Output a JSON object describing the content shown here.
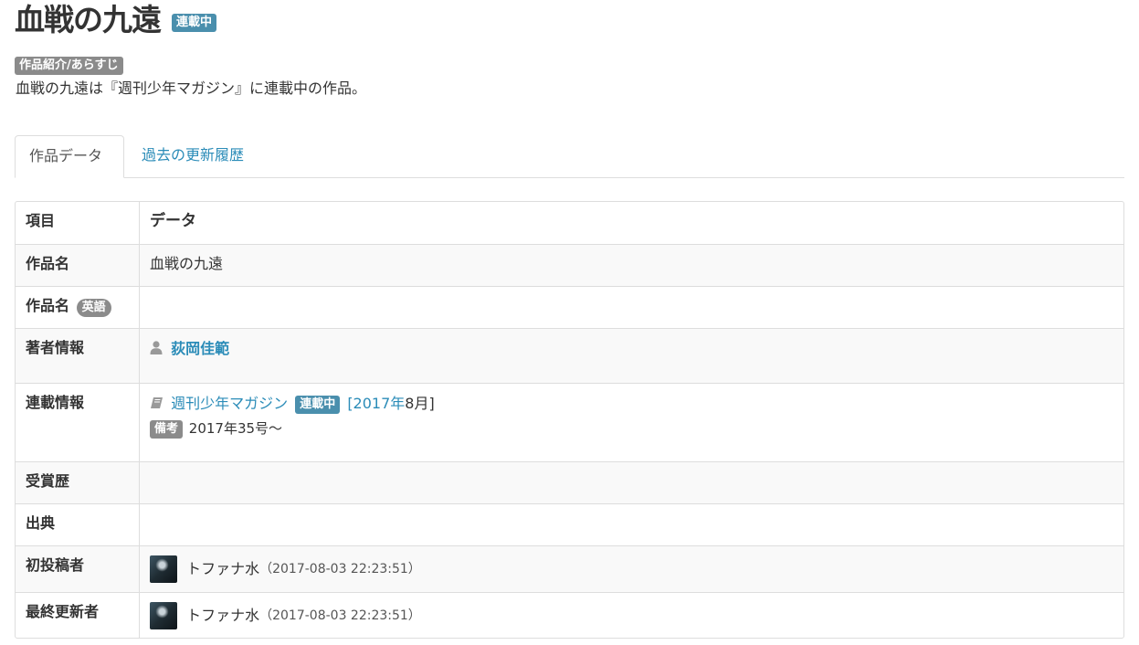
{
  "header": {
    "title": "血戦の九遠",
    "status_badge": "連載中"
  },
  "synopsis": {
    "label": "作品紹介/あらすじ",
    "text": "血戦の九遠は『週刊少年マガジン』に連載中の作品。"
  },
  "tabs": [
    {
      "label": "作品データ",
      "active": true
    },
    {
      "label": "過去の更新履歴",
      "active": false
    }
  ],
  "table": {
    "header": {
      "label": "項目",
      "value": "データ"
    },
    "title_row": {
      "label": "作品名",
      "value": "血戦の九遠"
    },
    "english_title_row": {
      "label": "作品名",
      "badge": "英語",
      "value": ""
    },
    "author_row": {
      "label": "著者情報",
      "author": "荻岡佳範",
      "icon": "user-icon"
    },
    "serial_row": {
      "label": "連載情報",
      "icon": "book-icon",
      "magazine": "週刊少年マガジン",
      "status_badge": "連載中",
      "date_prefix": "[2017年",
      "date_suffix": "8月]",
      "note_label": "備考",
      "note_text": "2017年35号〜"
    },
    "awards_row": {
      "label": "受賞歴",
      "value": ""
    },
    "source_row": {
      "label": "出典",
      "value": ""
    },
    "first_poster_row": {
      "label": "初投稿者",
      "user": "トファナ水",
      "timestamp": "（2017-08-03 22:23:51）"
    },
    "last_editor_row": {
      "label": "最終更新者",
      "user": "トファナ水",
      "timestamp": "（2017-08-03 22:23:51）"
    }
  },
  "colors": {
    "accent_link": "#2b8cb8",
    "status_badge_bg": "#4a8fad",
    "gray_badge_bg": "#8b8b8b",
    "border": "#dddddd",
    "alt_row_bg": "#f9f9f9"
  }
}
